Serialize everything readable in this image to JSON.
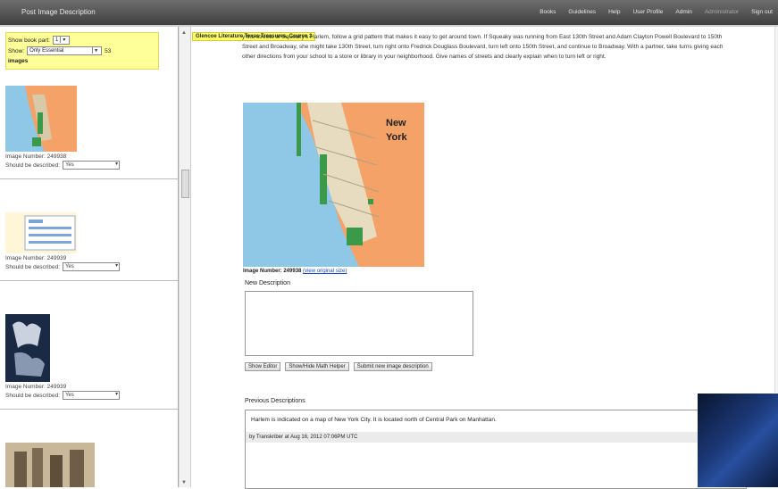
{
  "topbar": {
    "title": "Post Image Description",
    "nav": [
      "Books",
      "Guidelines",
      "Help",
      "User Profile",
      "Admin",
      "Administrator",
      "Sign out"
    ]
  },
  "sidebar": {
    "show_book_part_label": "Show book part:",
    "show_book_part_value": "1",
    "show_label": "Show:",
    "show_value": "Only Essential",
    "count": "53",
    "images_label": "images",
    "items": [
      {
        "image_number": "Image Number: 249938",
        "should_label": "Should be described:",
        "should_value": "Yes"
      },
      {
        "image_number": "Image Number: 249939",
        "should_label": "Should be described:",
        "should_value": "Yes"
      },
      {
        "image_number": "Image Number: 249939",
        "should_label": "Should be described:",
        "should_value": "Yes"
      }
    ]
  },
  "main": {
    "course_tag": "Glencoe Literature Texas Treasures, Course 3",
    "instructions": "y the streets of Squeaky's Harlem, follow a grid pattern that makes it easy to get around town. If Squeaky was running from East 130th Street and Adam Clayton Powell Boulevard to 150th Street and Broadway, she might take 130th Street, turn right onto Fredrick Douglass Boulevard, turn left onto 150th Street, and continue to Broadway. With a partner, take turns giving each other directions from your school to a store or library in your neighborhood. Give names of streets and clearly explain when to turn left or right.",
    "map_label_line1": "New",
    "map_label_line2": "York",
    "image_number": "Image Number: 249938",
    "original_size_link": "(view original size)",
    "new_description_label": "New Description",
    "buttons": [
      "Show Editor",
      "Show/Hide Math Helper",
      "Submit new image description"
    ],
    "previous_label": "Previous Descriptions",
    "previous_text": "Harlem is indicated on a map of New York City. It is located north of Central Park on Manhattan.",
    "previous_meta": "by Transkriber at Aug 16, 2012 07:06PM UTC"
  },
  "colors": {
    "highlight": "#ffff99",
    "map_water": "#8fc8e6",
    "map_land": "#f4a267",
    "link": "#1a4cc8"
  }
}
